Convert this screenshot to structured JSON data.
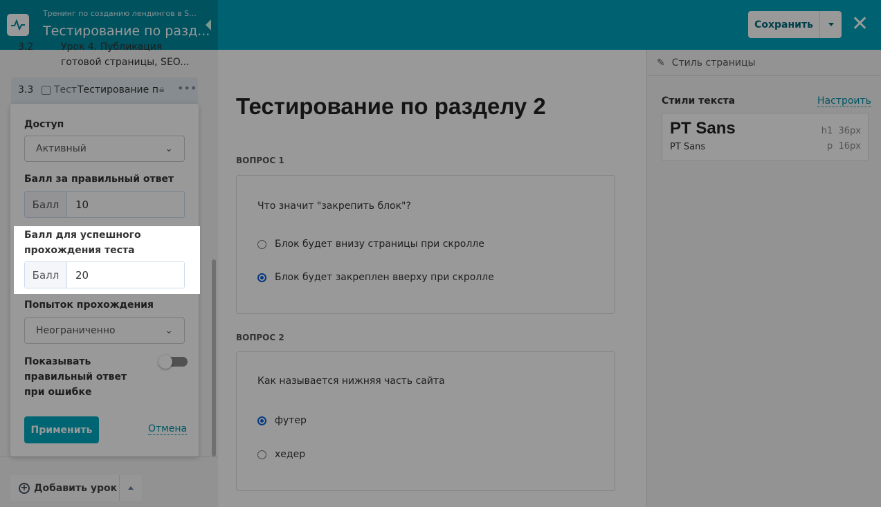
{
  "header": {
    "breadcrumb": "Тренинг по созданию лендингов в S...",
    "title": "Тестирование по разд...",
    "save_label": "Сохранить"
  },
  "sidebar": {
    "lessons": [
      {
        "num": "3.2",
        "title_line1": "Урок 4. Публикация",
        "title_line2": "готовой страницы, SEO..."
      },
      {
        "num": "3.3",
        "type": "Тест",
        "title": "Тестирование по"
      }
    ],
    "add_lesson": "Добавить урок"
  },
  "popover": {
    "access_label": "Доступ",
    "access_value": "Активный",
    "points_label": "Балл за правильный ответ",
    "points_addon": "Балл",
    "points_value": "10",
    "pass_label_line1": "Балл для успешного",
    "pass_label_line2": "прохождения теста",
    "pass_addon": "Балл",
    "pass_value": "20",
    "attempts_label": "Попыток прохождения",
    "attempts_value": "Неограниченно",
    "show_answer_line1": "Показывать",
    "show_answer_line2": "правильный ответ",
    "show_answer_line3": "при ошибке",
    "show_answer_on": false,
    "apply": "Применить",
    "cancel": "Отмена"
  },
  "main": {
    "title": "Тестирование по разделу 2",
    "questions": [
      {
        "label": "ВОПРОС 1",
        "text": "Что значит \"закрепить блок\"?",
        "options": [
          {
            "text": "Блок будет внизу страницы при скролле",
            "checked": false
          },
          {
            "text": "Блок будет закреплен вверху при скролле",
            "checked": true
          }
        ]
      },
      {
        "label": "ВОПРОС 2",
        "text": "Как называется нижняя часть сайта",
        "options": [
          {
            "text": "футер",
            "checked": true
          },
          {
            "text": "хедер",
            "checked": false
          }
        ]
      }
    ]
  },
  "right": {
    "tab": "Стиль страницы",
    "styles_label": "Стили текста",
    "configure": "Настроить",
    "font_h1": "PT Sans",
    "font_p": "PT Sans",
    "h1_tag": "h1",
    "h1_size": "36px",
    "p_tag": "p",
    "p_size": "16px"
  }
}
